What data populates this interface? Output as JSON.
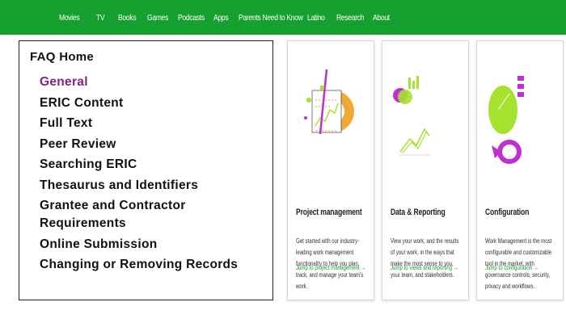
{
  "nav": {
    "items": [
      "Movies",
      "TV",
      "Books",
      "Games",
      "Podcasts",
      "Apps",
      "Parents Need to Know",
      "Latino",
      "Research",
      "About"
    ]
  },
  "faq": {
    "title": "FAQ Home",
    "items": [
      "General",
      "ERIC Content",
      "Full Text",
      "Peer Review",
      "Searching ERIC",
      "Thesaurus and Identifiers",
      "Grantee and Contractor Requirements",
      "Online Submission",
      "Changing or Removing Records"
    ],
    "active_index": 0
  },
  "cards": [
    {
      "title": "Project management",
      "description": "Get started with our industry-leading work management functionality to help you plan, track, and manage your team's work.",
      "link": "Jump to project management →",
      "icon": "project-management-illustration"
    },
    {
      "title": "Data & Reporting",
      "description": "View your work, and the results of your work, in the ways that make the most sense to you, your team, and stakeholders.",
      "link": "Jump to views and reporting →",
      "icon": "data-reporting-illustration"
    },
    {
      "title": "Configuration",
      "description": "Work Management is the most configurable and customizable tool in the market, with governance controls, security, privacy and workflows.",
      "link": "Jump to configuration →",
      "icon": "configuration-illustration"
    }
  ],
  "colors": {
    "nav_bg": "#16a02f",
    "active_link": "#8a1e82",
    "card_link": "#1c9a2e",
    "accent_lime": "#a6e22e",
    "accent_purple": "#c02fd0",
    "accent_orange": "#f0a020"
  }
}
